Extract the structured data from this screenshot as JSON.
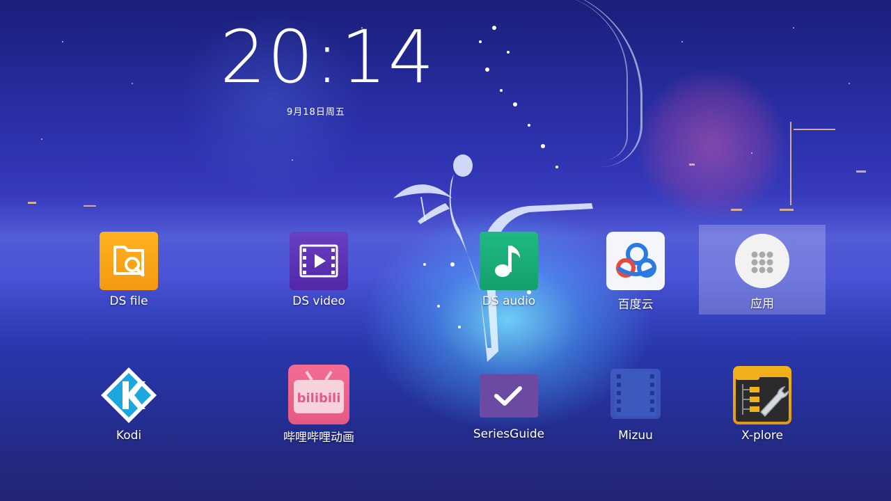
{
  "clock": {
    "time": "20:14",
    "date": "9月18日周五"
  },
  "apps": [
    {
      "id": "ds-file",
      "label": "DS file",
      "icon": "ds-file-icon"
    },
    {
      "id": "ds-video",
      "label": "DS video",
      "icon": "ds-video-icon"
    },
    {
      "id": "ds-audio",
      "label": "DS audio",
      "icon": "ds-audio-icon"
    },
    {
      "id": "baidu-cloud",
      "label": "百度云",
      "icon": "baidu-cloud-icon"
    },
    {
      "id": "apps",
      "label": "应用",
      "icon": "apps-grid-icon"
    },
    {
      "id": "kodi",
      "label": "Kodi",
      "icon": "kodi-icon"
    },
    {
      "id": "bilibili",
      "label": "哔哩哔哩动画",
      "icon": "bilibili-icon"
    },
    {
      "id": "seriesguide",
      "label": "SeriesGuide",
      "icon": "seriesguide-icon"
    },
    {
      "id": "mizuu",
      "label": "Mizuu",
      "icon": "mizuu-icon"
    },
    {
      "id": "x-plore",
      "label": "X-plore",
      "icon": "x-plore-icon"
    }
  ],
  "icon_text": {
    "bilibili": "bilibili"
  },
  "colors": {
    "highlight": "rgba(255,255,255,0.22)",
    "text": "#ffffff"
  }
}
